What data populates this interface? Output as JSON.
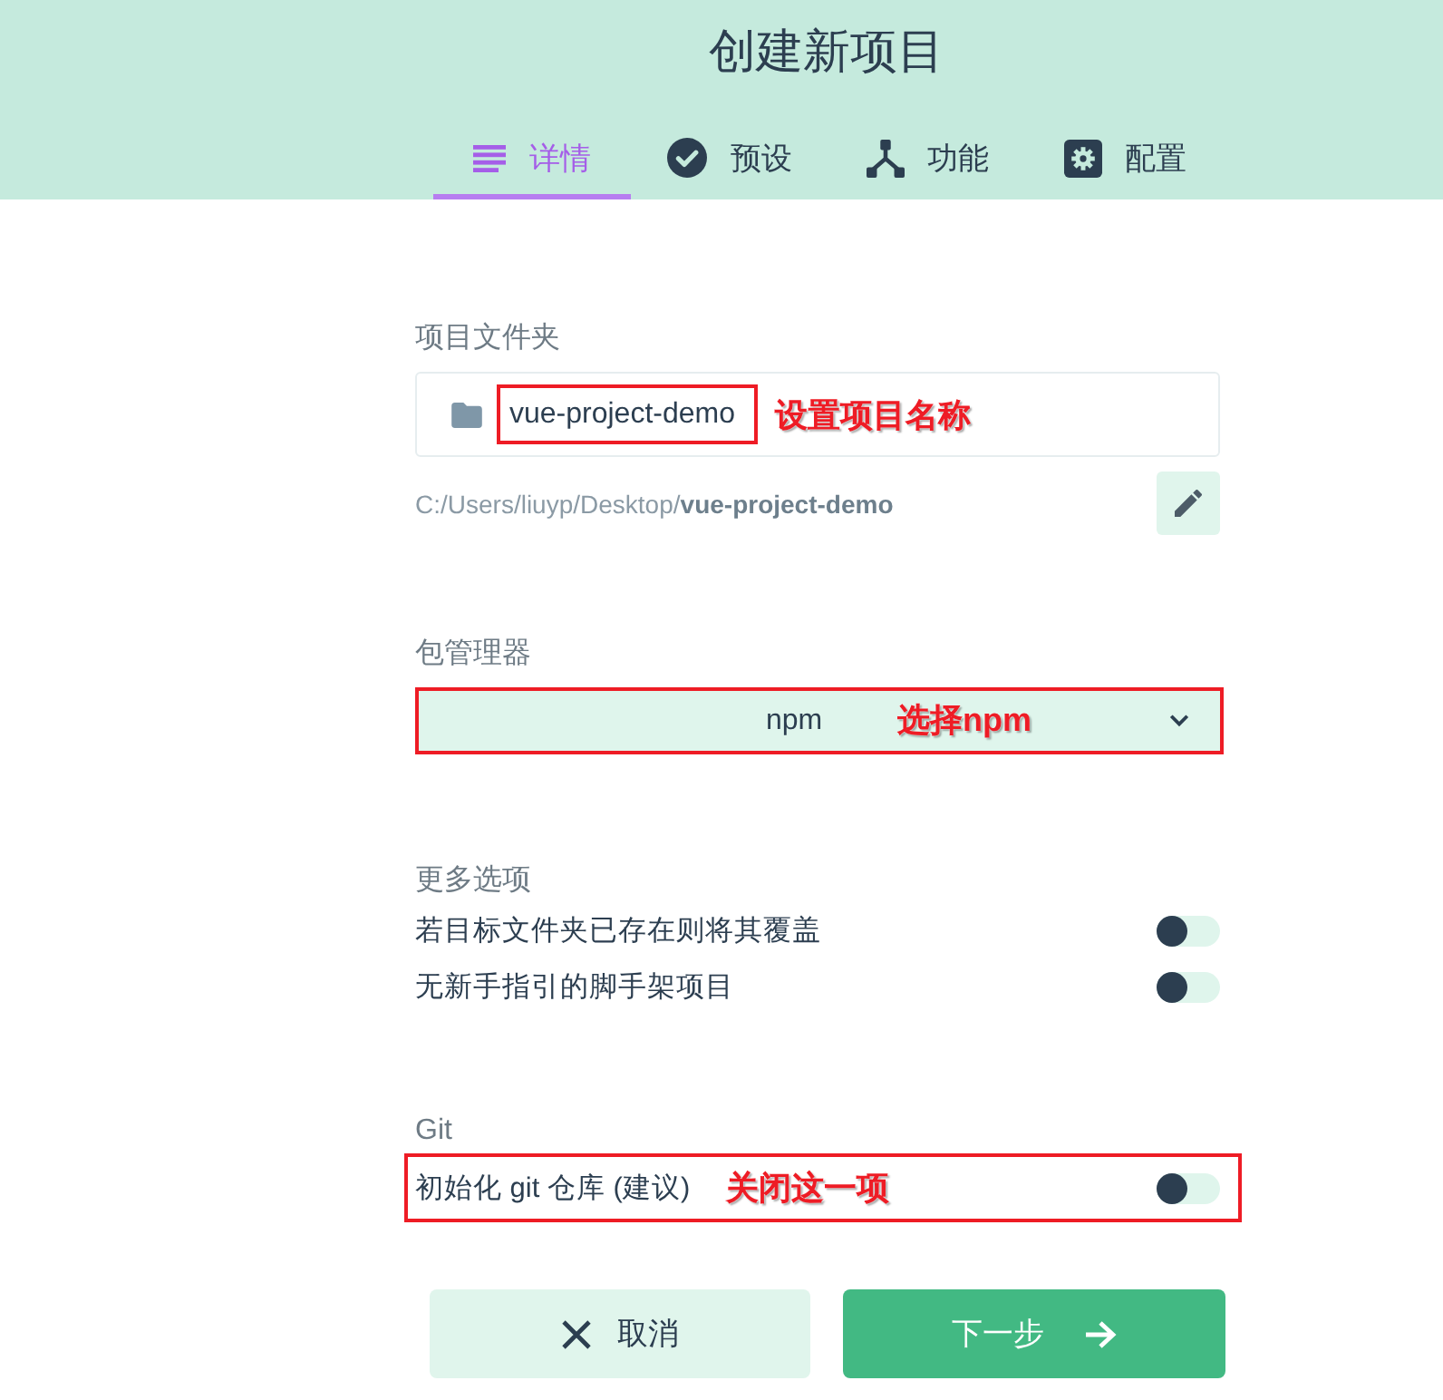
{
  "header": {
    "title": "创建新项目"
  },
  "tabs": [
    {
      "label": "详情",
      "selected": true
    },
    {
      "label": "预设",
      "selected": false
    },
    {
      "label": "功能",
      "selected": false
    },
    {
      "label": "配置",
      "selected": false
    }
  ],
  "project_folder": {
    "label": "项目文件夹",
    "value": "vue-project-demo",
    "highlighted": true,
    "note": "设置项目名称",
    "path": "C:/Users/liuyp/Desktop/**vue-project-demo**"
  },
  "package_manager": {
    "label": "包管理器",
    "value": "npm",
    "highlighted": true,
    "note": "选择npm"
  },
  "more_options": {
    "label": "更多选项",
    "options": [
      {
        "label": "若目标文件夹已存在则将其覆盖",
        "on": false
      },
      {
        "label": "无新手指引的脚手架项目",
        "on": false
      }
    ]
  },
  "git": {
    "label": "Git",
    "options": [
      {
        "label": "初始化 git 仓库 (建议)",
        "on": false,
        "highlighted": true,
        "note": "关闭这一项"
      }
    ]
  },
  "buttons": [
    {
      "label": "取消",
      "kind": "cancel"
    },
    {
      "label": "下一步",
      "kind": "next"
    }
  ]
}
